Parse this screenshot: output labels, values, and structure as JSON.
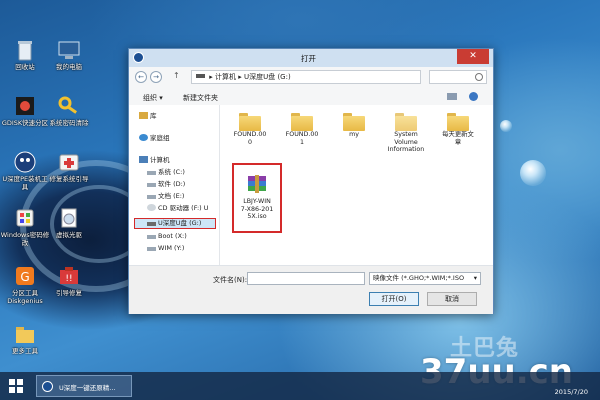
{
  "desktop": {
    "icons": [
      {
        "label": "回收站",
        "icon": "recycle-bin-icon"
      },
      {
        "label": "我的电脑",
        "icon": "computer-icon"
      },
      {
        "label": "GDISK快速分区",
        "icon": "gdisk-icon"
      },
      {
        "label": "系统密码清除",
        "icon": "key-icon"
      },
      {
        "label": "U深度PE装机工具",
        "icon": "udeepin-pe-icon"
      },
      {
        "label": "修复系统引导",
        "icon": "first-aid-icon"
      },
      {
        "label": "Windows密码修改",
        "icon": "windows-password-icon"
      },
      {
        "label": "虚拟光驱",
        "icon": "virtual-drive-icon"
      },
      {
        "label": "分区工具Diskgenius",
        "icon": "diskgenius-icon"
      },
      {
        "label": "引导修复",
        "icon": "boot-repair-icon"
      },
      {
        "label": "更多工具",
        "icon": "folder-icon"
      }
    ],
    "watermark_small": "土巴兔",
    "watermark_large": "37uu.cn"
  },
  "dialog": {
    "title": "打开",
    "close_glyph": "✕",
    "address": {
      "back": "←",
      "forward": "→",
      "up": "↑",
      "path": [
        "计算机",
        "U深度U盘 (G:)"
      ]
    },
    "toolbar": {
      "organize": "组织 ▾",
      "new_folder": "新建文件夹"
    },
    "nav": [
      {
        "label": "库",
        "indent": 1,
        "icon": "library-icon"
      },
      {
        "label": "家庭组",
        "indent": 1,
        "icon": "homegroup-icon"
      },
      {
        "label": "计算机",
        "indent": 1,
        "icon": "computer-icon"
      },
      {
        "label": "系统 (C:)",
        "indent": 2,
        "icon": "drive-icon"
      },
      {
        "label": "软件 (D:)",
        "indent": 2,
        "icon": "drive-icon"
      },
      {
        "label": "文档 (E:)",
        "indent": 2,
        "icon": "drive-icon"
      },
      {
        "label": "CD 驱动器 (F:) U",
        "indent": 2,
        "icon": "cd-drive-icon"
      },
      {
        "label": "U深度U盘 (G:)",
        "indent": 2,
        "icon": "usb-drive-icon",
        "selected": true
      },
      {
        "label": "Boot (X:)",
        "indent": 2,
        "icon": "drive-icon"
      },
      {
        "label": "WIM (Y:)",
        "indent": 2,
        "icon": "drive-icon"
      }
    ],
    "files": [
      {
        "name": "FOUND.000",
        "lines": [
          "FOUND.00",
          "0"
        ],
        "type": "folder"
      },
      {
        "name": "FOUND.001",
        "lines": [
          "FOUND.00",
          "1"
        ],
        "type": "folder"
      },
      {
        "name": "my",
        "lines": [
          "my"
        ],
        "type": "folder"
      },
      {
        "name": "System Volume Information",
        "lines": [
          "System",
          "Volume",
          "Information"
        ],
        "type": "folder"
      },
      {
        "name": "每天更新文章",
        "lines": [
          "每天更新文",
          "章"
        ],
        "type": "folder"
      },
      {
        "name": "LBJY-WIN7-X86-2015X.iso",
        "lines": [
          "LBJY-WIN",
          "7-X86-201",
          "5X.iso"
        ],
        "type": "iso"
      }
    ],
    "filename_label": "文件名(N):",
    "filename_value": "",
    "filetype_value": "映像文件 (*.GHO;*.WIM;*.ISO",
    "open_label": "打开(O)",
    "cancel_label": "取消"
  },
  "taskbar": {
    "task_label": "U深度一键还原精...",
    "clock": "2015/7/20"
  },
  "colors": {
    "accent": "#d42a2a",
    "close": "#c93c33",
    "folder": "#e8b945"
  }
}
